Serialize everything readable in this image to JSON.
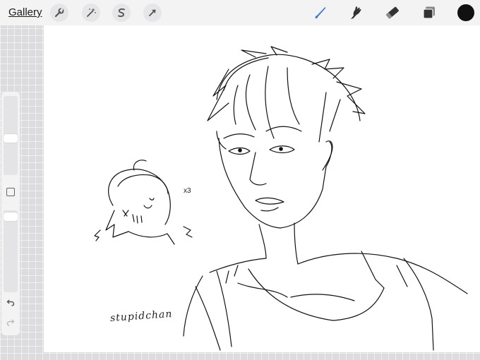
{
  "toolbar": {
    "gallery_label": "Gallery",
    "tools_left": [
      "wrench-icon",
      "magic-wand-icon",
      "selection-s-icon",
      "transform-arrow-icon"
    ],
    "tools_right": [
      "brush-icon",
      "smudge-icon",
      "eraser-icon",
      "layers-icon"
    ],
    "active_tool": "brush",
    "active_color": "#111111",
    "accent": "#3a7bd5"
  },
  "sidebar": {
    "brush_size_level": 0.46,
    "opacity_level": 0.03
  },
  "canvas": {
    "annotation": "x3",
    "signature": "stupidchan"
  }
}
